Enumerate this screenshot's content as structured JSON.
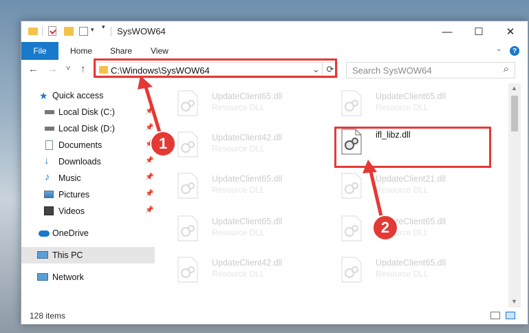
{
  "window": {
    "title": "SysWOW64",
    "minimize_glyph": "—",
    "maximize_glyph": "☐",
    "close_glyph": "✕"
  },
  "ribbon": {
    "file": "File",
    "tabs": [
      "Home",
      "Share",
      "View"
    ],
    "help": "?"
  },
  "nav": {
    "back": "←",
    "forward": "→",
    "recent": "˅",
    "up": "↑",
    "address": "C:\\Windows\\SysWOW64",
    "dropdown": "⌄",
    "refresh": "⟳",
    "search_placeholder": "Search SysWOW64",
    "search_icon": "⌕"
  },
  "sidebar": {
    "items": [
      {
        "label": "Quick access",
        "icon": "star-icon"
      },
      {
        "label": "Local Disk (C:)",
        "icon": "drive-icon",
        "pinned": true
      },
      {
        "label": "Local Disk (D:)",
        "icon": "drive-icon",
        "pinned": true
      },
      {
        "label": "Documents",
        "icon": "documents-icon",
        "pinned": true
      },
      {
        "label": "Downloads",
        "icon": "downloads-icon",
        "pinned": true
      },
      {
        "label": "Music",
        "icon": "music-icon",
        "pinned": true
      },
      {
        "label": "Pictures",
        "icon": "pictures-icon",
        "pinned": true
      },
      {
        "label": "Videos",
        "icon": "videos-icon",
        "pinned": true
      },
      {
        "label": "OneDrive",
        "icon": "onedrive-icon"
      },
      {
        "label": "This PC",
        "icon": "this-pc-icon",
        "selected": true
      },
      {
        "label": "Network",
        "icon": "network-icon"
      }
    ],
    "pin_glyph": "📌"
  },
  "files": [
    {
      "name": "UpdateClient65.dll",
      "type": "Resource DLL"
    },
    {
      "name": "UpdateClient65.dll",
      "type": "Resource DLL"
    },
    {
      "name": "UpdateClient42.dll",
      "type": "Resource DLL"
    },
    {
      "name": "ifl_libz.dll",
      "type": ""
    },
    {
      "name": "UpdateClient65.dll",
      "type": "Resource DLL"
    },
    {
      "name": "UpdateClient21.dll",
      "type": "Resource DLL"
    },
    {
      "name": "UpdateClient65.dll",
      "type": "Resource DLL"
    },
    {
      "name": "UpdateClient65.dll",
      "type": "Resource DLL"
    },
    {
      "name": "UpdateClient42.dll",
      "type": "Resource DLL"
    },
    {
      "name": "UpdateClient65.dll",
      "type": "Resource DLL"
    }
  ],
  "status": {
    "count": "128 items"
  },
  "callouts": [
    "1",
    "2"
  ],
  "colors": {
    "accent": "#1979ca",
    "highlight_red": "#e53935",
    "folder": "#f4c24a"
  }
}
